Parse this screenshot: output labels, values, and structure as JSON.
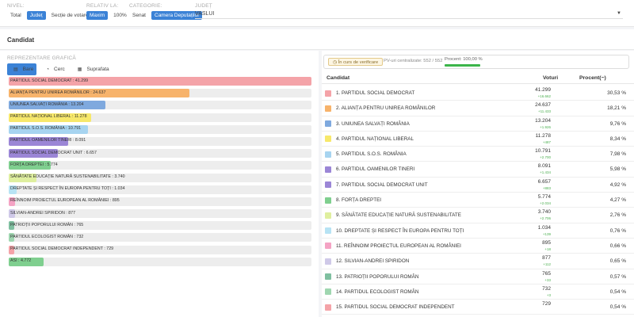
{
  "header": {
    "nivel_label": "NIVEL:",
    "nivel_options": [
      "Total",
      "Județ",
      "Secție de votare"
    ],
    "nivel_active": 1,
    "relativ_label": "Relativ la:",
    "relativ_options": [
      "Maxim",
      "100%"
    ],
    "relativ_active": 0,
    "categorie_label": "Categorie:",
    "categorie_options": [
      "Senat",
      "Camera Deputaților"
    ],
    "categorie_active": 1,
    "judet_label": "JUDEȚ",
    "judet_value": "VASLUI"
  },
  "section_title": "Candidat",
  "left": {
    "title": "REPREZENTARE GRAFICĂ",
    "view_options": [
      {
        "label": "Bare",
        "icon": "bar-chart-icon"
      },
      {
        "label": "Cerc",
        "icon": "circle-icon"
      },
      {
        "label": "Suprafata",
        "icon": "grid-icon"
      }
    ],
    "view_active": 0
  },
  "status": {
    "state": "În curs de verificare",
    "pv": "PV-uri centralizate: 552 / 552",
    "procent": "Procent: 100,00 %"
  },
  "table": {
    "col_candidat": "Candidat",
    "col_voturi": "Voturi",
    "col_procent": "Procent(~)"
  },
  "chart_data": {
    "type": "bar",
    "title": "",
    "xlabel": "",
    "ylabel": "",
    "categories": [
      "PARTIDUL SOCIAL DEMOCRAT",
      "ALIANȚA PENTRU UNIREA ROMÂNILOR",
      "UNIUNEA SALVAȚI ROMÂNIA",
      "PARTIDUL NAȚIONAL LIBERAL",
      "PARTIDUL S.O.S. ROMÂNIA",
      "PARTIDUL OAMENILOR TINERI",
      "PARTIDUL SOCIAL DEMOCRAT UNIT",
      "FORȚA DREPTEI",
      "SĂNĂTATE EDUCAȚIE NATURĂ SUSTENABILITATE",
      "DREPTATE ȘI RESPECT ÎN EUROPA PENTRU TOȚI",
      "REÎNNOIM PROIECTUL EUROPEAN AL ROMÂNIEI",
      "SILVIAN-ANDREI SPIRIDON",
      "PATRIOȚII POPORULUI ROMÂN",
      "PARTIDUL ECOLOGIST ROMÂN",
      "PARTIDUL SOCIAL DEMOCRAT INDEPENDENT",
      "ASI"
    ],
    "values": [
      41299,
      24637,
      13204,
      11278,
      10791,
      8091,
      6657,
      5774,
      3740,
      1034,
      895,
      877,
      765,
      732,
      729,
      4772
    ],
    "colors": [
      "#f4a3a8",
      "#f7b36b",
      "#7fa9de",
      "#f7e86b",
      "#a7d4f0",
      "#9b86d6",
      "#9b86d6",
      "#7fcf8f",
      "#dfef9f",
      "#b7e3f4",
      "#f4a3c4",
      "#cfc9e8",
      "#7fbfa0",
      "#9fd6b0",
      "#f4a3a8",
      "#7fcf8f"
    ]
  },
  "rows": [
    {
      "name": "1. PARTIDUL SOCIAL DEMOCRAT",
      "votes": "41.299",
      "delta": "+16.662",
      "pct": "30,53 %",
      "color": "#f4a3a8"
    },
    {
      "name": "2. ALIANȚA PENTRU UNIREA ROMÂNILOR",
      "votes": "24.637",
      "delta": "+11.433",
      "pct": "18,21 %",
      "color": "#f7b36b"
    },
    {
      "name": "3. UNIUNEA SALVAȚI ROMÂNIA",
      "votes": "13.204",
      "delta": "+1.926",
      "pct": "9,76 %",
      "color": "#7fa9de"
    },
    {
      "name": "4. PARTIDUL NAȚIONAL LIBERAL",
      "votes": "11.278",
      "delta": "+487",
      "pct": "8,34 %",
      "color": "#f7e86b"
    },
    {
      "name": "5. PARTIDUL S.O.S. ROMÂNIA",
      "votes": "10.791",
      "delta": "+2.700",
      "pct": "7,98 %",
      "color": "#a7d4f0"
    },
    {
      "name": "6. PARTIDUL OAMENILOR TINERI",
      "votes": "8.091",
      "delta": "+1.434",
      "pct": "5,98 %",
      "color": "#9b86d6"
    },
    {
      "name": "7. PARTIDUL SOCIAL DEMOCRAT UNIT",
      "votes": "6.657",
      "delta": "+883",
      "pct": "4,92 %",
      "color": "#9b86d6"
    },
    {
      "name": "8. FORȚA DREPTEI",
      "votes": "5.774",
      "delta": "+2.034",
      "pct": "4,27 %",
      "color": "#7fcf8f"
    },
    {
      "name": "9. SĂNĂTATE EDUCAȚIE NATURĂ SUSTENABILITATE",
      "votes": "3.740",
      "delta": "+2.706",
      "pct": "2,76 %",
      "color": "#dfef9f"
    },
    {
      "name": "10. DREPTATE ȘI RESPECT ÎN EUROPA PENTRU TOȚI",
      "votes": "1.034",
      "delta": "+139",
      "pct": "0,76 %",
      "color": "#b7e3f4"
    },
    {
      "name": "11. REÎNNOIM PROIECTUL EUROPEAN AL ROMÂNIEI",
      "votes": "895",
      "delta": "+18",
      "pct": "0,66 %",
      "color": "#f4a3c4"
    },
    {
      "name": "12. SILVIAN-ANDREI SPIRIDON",
      "votes": "877",
      "delta": "+112",
      "pct": "0,65 %",
      "color": "#cfc9e8"
    },
    {
      "name": "13. PATRIOȚII POPORULUI ROMÂN",
      "votes": "765",
      "delta": "+33",
      "pct": "0,57 %",
      "color": "#7fbfa0"
    },
    {
      "name": "14. PARTIDUL ECOLOGIST ROMÂN",
      "votes": "732",
      "delta": "+3",
      "pct": "0,54 %",
      "color": "#9fd6b0"
    },
    {
      "name": "15. PARTIDUL SOCIAL DEMOCRAT INDEPENDENT",
      "votes": "729",
      "delta": "",
      "pct": "0,54 %",
      "color": "#f4a3a8"
    }
  ]
}
